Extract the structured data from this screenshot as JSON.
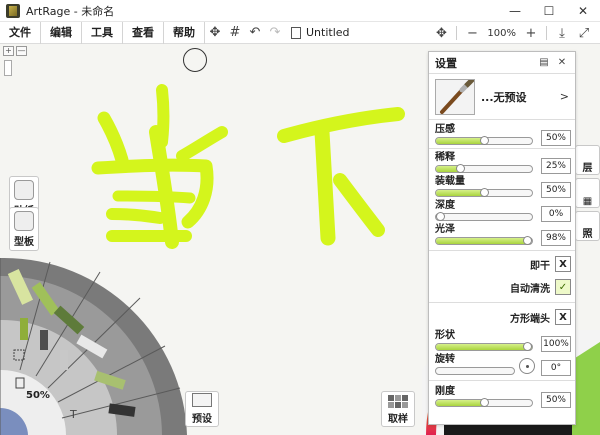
{
  "window": {
    "app_name": "ArtRage",
    "document_name": "未命名",
    "title": "ArtRage - 未命名"
  },
  "menu": [
    "文件",
    "编辑",
    "工具",
    "查看",
    "帮助"
  ],
  "toolbar": {
    "document_title": "Untitled",
    "zoom": "100%"
  },
  "icons": {
    "minimize": "—",
    "maximize": "☐",
    "close": "✕",
    "move": "✥",
    "grid": "#",
    "undo": "↶",
    "redo": "↷",
    "zoom_minus": "−",
    "zoom_plus": "+",
    "fullscreen": "⤢",
    "download": "⤓",
    "mini_tool_1": "+",
    "mini_tool_2": "—"
  },
  "left_tools": {
    "stickers": "贴纸",
    "stencils": "型板"
  },
  "tool_wheel": {
    "opacity_pct": "50%"
  },
  "bottom": {
    "presets_label": "预设",
    "sample_label": "取样"
  },
  "right_edge": {
    "layers": "层",
    "tracing": "照"
  },
  "panel": {
    "title": "设置",
    "preset_name": "...无预设",
    "preset_arrow": ">",
    "params": [
      {
        "label": "压感",
        "value": "50%",
        "level": 50
      },
      {
        "label": "稀释",
        "value": "25%",
        "level": 25
      },
      {
        "label": "装载量",
        "value": "50%",
        "level": 50
      },
      {
        "label": "深度",
        "value": "0%",
        "level": 0
      },
      {
        "label": "光泽",
        "value": "98%",
        "level": 98
      }
    ],
    "toggles": [
      {
        "label": "即干",
        "state": "X",
        "on": false
      },
      {
        "label": "自动清洗",
        "state": "✓",
        "on": true
      },
      {
        "label": "方形端头",
        "state": "X",
        "on": false
      }
    ],
    "shape": {
      "label": "形状",
      "value": "100%",
      "level": 100
    },
    "rotation": {
      "label": "旋转",
      "value": "0°"
    },
    "stiffness": {
      "label": "刚度",
      "value": "50%",
      "level": 50
    }
  },
  "colors": {
    "stroke": "#d4f51c",
    "slider_fill": "#b6dd4c"
  }
}
